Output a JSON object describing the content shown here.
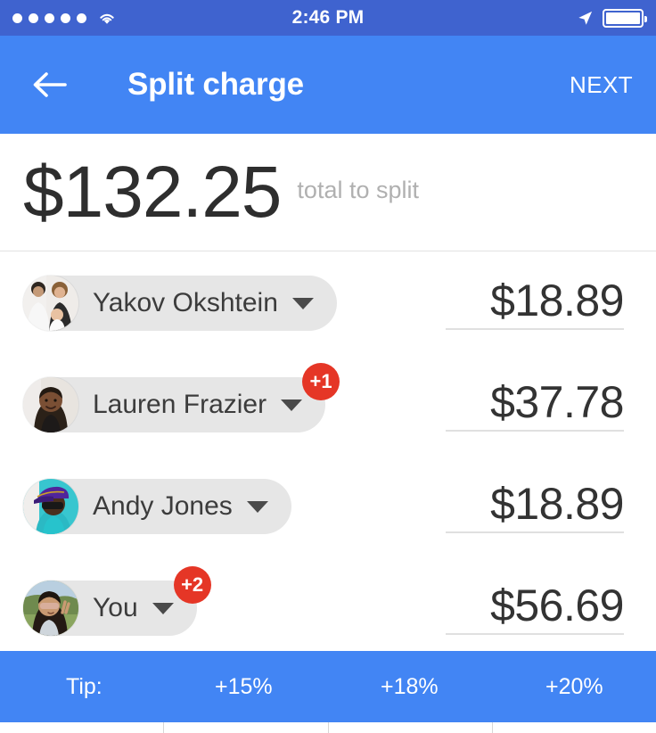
{
  "status_bar": {
    "time": "2:46 PM",
    "signal_dots": 5,
    "wifi_icon": "wifi-icon",
    "location_icon": "location-arrow-icon",
    "battery_icon": "battery-full-icon",
    "battery_level_percent": 100,
    "background_color": "#3f63cf"
  },
  "app_bar": {
    "back_icon": "back-arrow-icon",
    "title": "Split charge",
    "next_label": "NEXT",
    "background_color": "#4285f4"
  },
  "total": {
    "amount": "$132.25",
    "caption": "total to split"
  },
  "people": [
    {
      "name": "Yakov Okshtein",
      "amount": "$18.89",
      "badge": null,
      "avatar": "family-photo-avatar",
      "chevron_icon": "chevron-down-icon"
    },
    {
      "name": "Lauren Frazier",
      "amount": "$37.78",
      "badge": "+1",
      "avatar": "woman-portrait-avatar",
      "chevron_icon": "chevron-down-icon"
    },
    {
      "name": "Andy Jones",
      "amount": "$18.89",
      "badge": null,
      "avatar": "man-cap-sunglasses-avatar",
      "chevron_icon": "chevron-down-icon"
    },
    {
      "name": "You",
      "amount": "$56.69",
      "badge": "+2",
      "avatar": "woman-sunglasses-outdoor-avatar",
      "chevron_icon": "chevron-down-icon"
    }
  ],
  "tip_bar": {
    "label": "Tip:",
    "options": [
      "+15%",
      "+18%",
      "+20%"
    ],
    "background_color": "#4285f4"
  },
  "colors": {
    "accent_blue": "#4285f4",
    "status_blue": "#3f63cf",
    "badge_red": "#e53626",
    "pill_gray": "#e6e6e6"
  }
}
